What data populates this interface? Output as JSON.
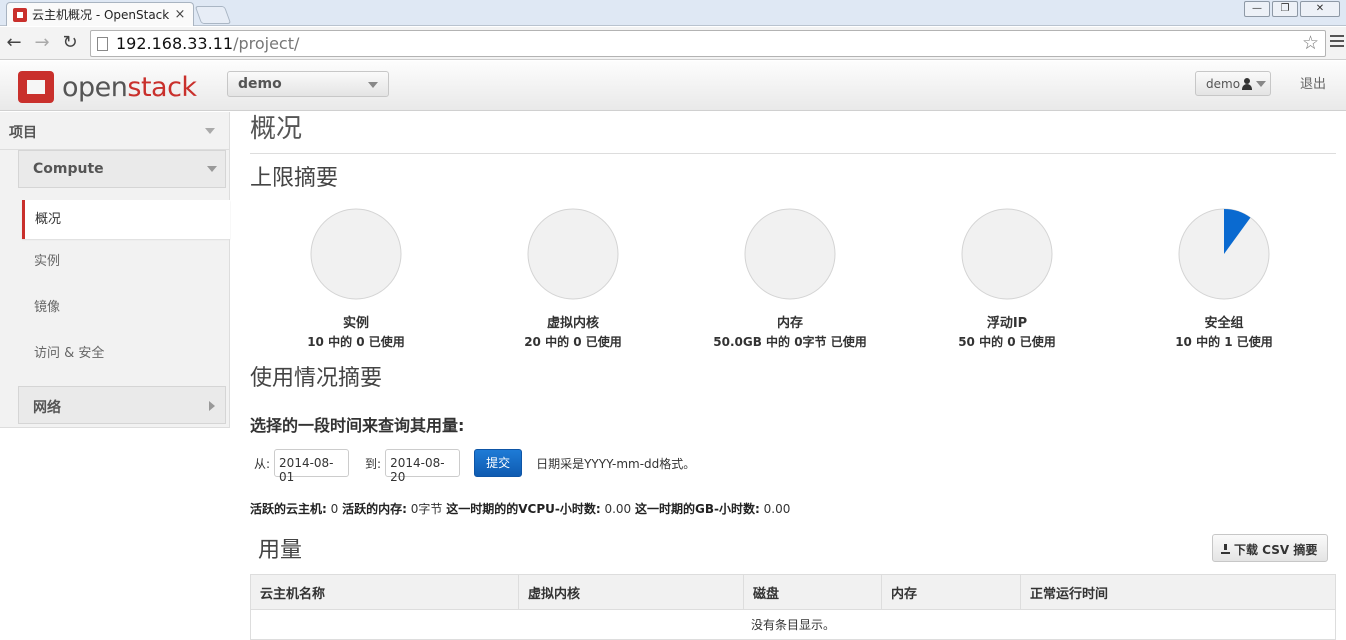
{
  "browser": {
    "tab_title": "云主机概况 - OpenStack",
    "tab_close": "×",
    "url_host": "192.168.33.11",
    "url_path": "/project/",
    "window_buttons": [
      "—",
      "❐",
      "✕"
    ]
  },
  "header": {
    "logo_open": "open",
    "logo_stack": "stack",
    "project_selector": "demo",
    "user_label": "demo",
    "logout": "退出"
  },
  "sidebar": {
    "top": "项目",
    "group": "Compute",
    "items": [
      {
        "label": "概况",
        "active": true
      },
      {
        "label": "实例",
        "active": false
      },
      {
        "label": "镜像",
        "active": false
      },
      {
        "label": "访问 & 安全",
        "active": false
      }
    ],
    "network_group": "网络"
  },
  "main": {
    "page_title": "概况",
    "limits_title": "上限摘要",
    "limits": [
      {
        "label": "实例",
        "value": "10 中的 0 已使用",
        "used_fraction": 0
      },
      {
        "label": "虚拟内核",
        "value": "20 中的 0 已使用",
        "used_fraction": 0
      },
      {
        "label": "内存",
        "value": "50.0GB 中的 0字节 已使用",
        "used_fraction": 0
      },
      {
        "label": "浮动IP",
        "value": "50 中的 0 已使用",
        "used_fraction": 0
      },
      {
        "label": "安全组",
        "value": "10 中的 1 已使用",
        "used_fraction": 0.1
      }
    ],
    "usage_title": "使用情况摘要",
    "query_title": "选择的一段时间来查询其用量:",
    "from_label": "从:",
    "from_date": "2014-08-01",
    "to_label": "到:",
    "to_date": "2014-08-20",
    "submit": "提交",
    "hint": "日期采是YYYY-mm-dd格式。",
    "stats": {
      "active_instances_label": "活跃的云主机:",
      "active_instances": "0",
      "active_memory_label": "活跃的内存:",
      "active_memory": "0字节",
      "vcpu_hours_label": "这一时期的的VCPU-小时数:",
      "vcpu_hours": "0.00",
      "gb_hours_label": "这一时期的GB-小时数:",
      "gb_hours": "0.00"
    },
    "usage_table_title": "用量",
    "csv_button": "下载 CSV 摘要",
    "table_headers": [
      "云主机名称",
      "虚拟内核",
      "磁盘",
      "内存",
      "正常运行时间"
    ],
    "empty_text": "没有条目显示。"
  },
  "colors": {
    "accent": "#c9302c",
    "primary_button": "#1565c0",
    "pie_fill": "#f1f1f1",
    "pie_used": "#0a6ad0"
  }
}
